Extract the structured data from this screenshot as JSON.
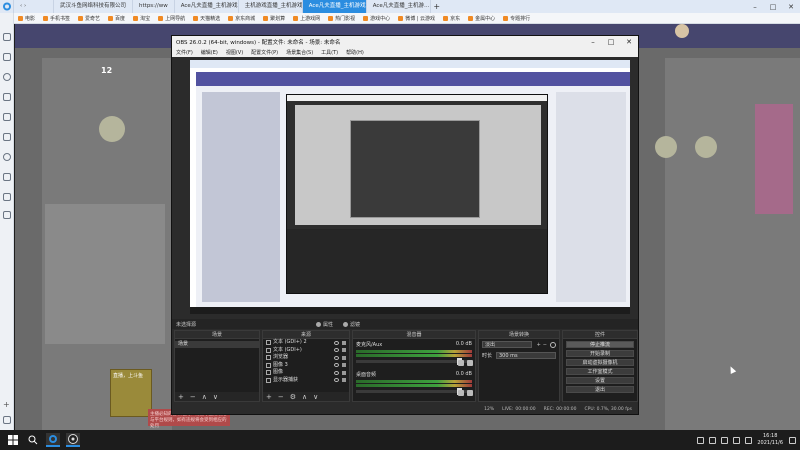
{
  "browser": {
    "tabs": [
      {
        "label": "首页",
        "active": false
      },
      {
        "label": "Ace凡夫直播_主机游戏…",
        "active": false
      },
      {
        "label": "主机游戏直播_主机游戏直播…",
        "active": false
      },
      {
        "label": "Ace凡夫直播_主机游戏直播…",
        "active": true
      },
      {
        "label": "Ace凡夫直播_主机游…",
        "active": false
      }
    ],
    "address_partial": "https://ww",
    "company_text": "武汉斗鱼网络科技有限公司",
    "bookmarks": [
      "电影",
      "手机书签",
      "爱奇艺",
      "百度",
      "淘宝",
      "上网导航",
      "天猫精选",
      "京东商城",
      "聚划算",
      "上游戏网",
      "热门影视",
      "游戏中心",
      "微博 | 云游戏",
      "京东",
      "金属中心",
      "京东",
      "专题排行"
    ],
    "accent": "#2b8de0"
  },
  "webpage": {
    "stat_number": "12",
    "promo_label": "直播，上斗鱼"
  },
  "obs": {
    "title": "OBS 26.0.2 (64-bit, windows) - 配置文件: 未命名 - 场景: 未命名",
    "menu": [
      "文件(F)",
      "编辑(E)",
      "视图(V)",
      "配置文件(P)",
      "场景集合(S)",
      "工具(T)",
      "帮助(H)"
    ],
    "source_bar_label": "未选择源",
    "source_toolbar": [
      "属性",
      "滤镜"
    ],
    "docks": {
      "scenes": {
        "title": "场景",
        "items": [
          "场景"
        ]
      },
      "sources": {
        "title": "来源",
        "items": [
          "文本 (GDI+) 2",
          "文本 (GDI+)",
          "浏览器",
          "图像 3",
          "图像",
          "显示器捕获"
        ]
      },
      "mixer": {
        "title": "混音器",
        "channels": [
          {
            "name": "麦克风/Aux",
            "level": "0.0 dB"
          },
          {
            "name": "桌面音频",
            "level": "0.0 dB"
          }
        ]
      },
      "transitions": {
        "title": "场景转换",
        "selected": "淡出",
        "duration_label": "时长",
        "duration_value": "300 ms"
      },
      "controls": {
        "title": "控件",
        "buttons": [
          "停止推流",
          "开始录制",
          "启动虚拟摄像机",
          "工作室模式",
          "设置",
          "退出"
        ]
      }
    },
    "status": {
      "live_label": "LIVE:",
      "live_time": "00:00:00",
      "rec_label": "REC:",
      "rec_time": "00:00:00",
      "cpu": "CPU: 0.7%, 30.00 fps",
      "drop": "12%"
    }
  },
  "red_notice": "主播必知的各项准则：请遵守直播规范与平台规则，如有违规将会受到相应的处罚",
  "taskbar": {
    "time": "16:18",
    "date": "2021/11/6"
  }
}
